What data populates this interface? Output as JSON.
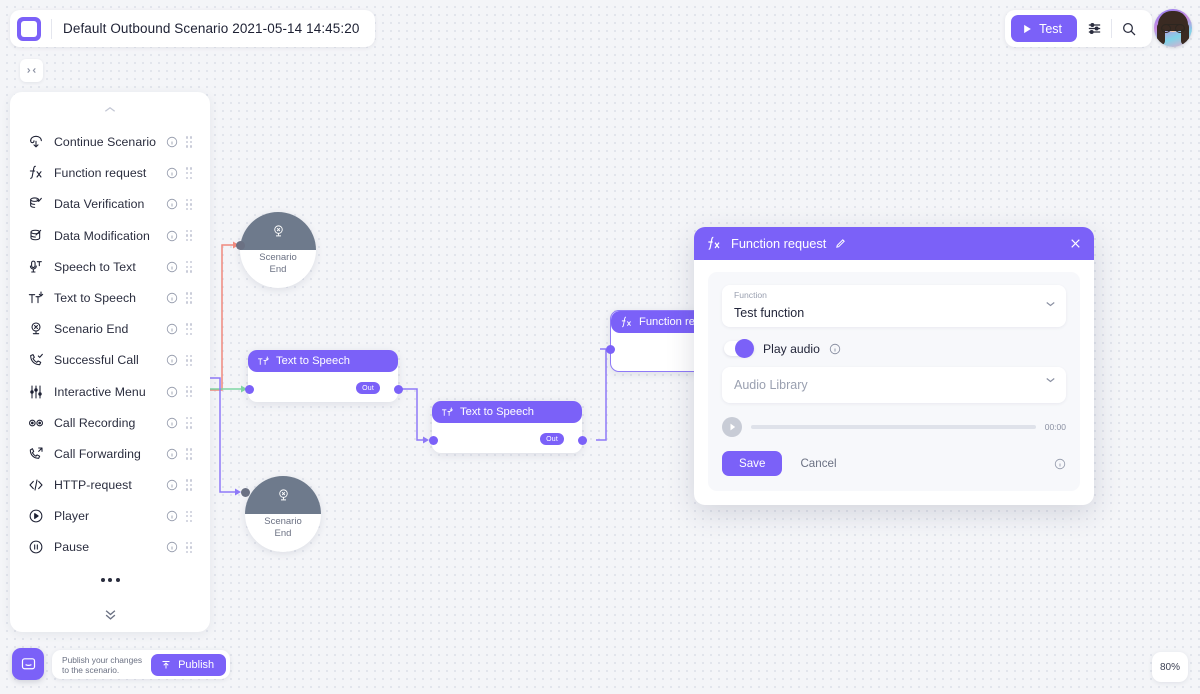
{
  "header": {
    "logo_icon": "edit-square-icon",
    "title": "Default Outbound Scenario 2021-05-14 14:45:20",
    "test_button": "Test",
    "settings_icon": "sliders-icon",
    "search_icon": "search-icon",
    "avatar": "user-avatar"
  },
  "sidebar": {
    "collapse_icon": "collapse-horizontal-icon",
    "scroll_up_icon": "chevron-up-icon",
    "scroll_down_icon": "chevrons-down-icon",
    "more_icon": "ellipsis-icon",
    "items": [
      {
        "label": "Continue Scenario",
        "icon": "continue-scenario-icon"
      },
      {
        "label": "Function request",
        "icon": "function-fx-icon"
      },
      {
        "label": "Data Verification",
        "icon": "data-verification-icon"
      },
      {
        "label": "Data Modification",
        "icon": "data-modification-icon"
      },
      {
        "label": "Speech to Text",
        "icon": "microphone-text-icon"
      },
      {
        "label": "Text to Speech",
        "icon": "text-speech-icon"
      },
      {
        "label": "Scenario End",
        "icon": "scenario-end-icon"
      },
      {
        "label": "Successful Call",
        "icon": "successful-call-icon"
      },
      {
        "label": "Interactive Menu",
        "icon": "sliders-menu-icon"
      },
      {
        "label": "Call Recording",
        "icon": "call-recording-icon"
      },
      {
        "label": "Call Forwarding",
        "icon": "call-forwarding-icon"
      },
      {
        "label": "HTTP-request",
        "icon": "code-brackets-icon"
      },
      {
        "label": "Player",
        "icon": "play-circle-icon"
      },
      {
        "label": "Pause",
        "icon": "pause-circle-icon"
      }
    ]
  },
  "canvas": {
    "nodes": [
      {
        "id": "end-top",
        "type": "scenario-end",
        "label": "Scenario\nEnd",
        "line1": "Scenario",
        "line2": "End",
        "icon": "scenario-end-icon"
      },
      {
        "id": "end-bot",
        "type": "scenario-end",
        "label": "Scenario\nEnd",
        "line1": "Scenario",
        "line2": "End",
        "icon": "scenario-end-icon"
      },
      {
        "id": "tts-1",
        "type": "text-to-speech",
        "label": "Text to Speech",
        "icon": "text-speech-icon",
        "out_badge": "Out"
      },
      {
        "id": "tts-2",
        "type": "text-to-speech",
        "label": "Text to Speech",
        "icon": "text-speech-icon",
        "out_badge": "Out"
      },
      {
        "id": "func-1",
        "type": "function-request",
        "label": "Function request",
        "icon": "function-fx-icon"
      }
    ],
    "edge_colors": {
      "red": "#f08a7e",
      "green": "#7fd6a4",
      "purple": "#8e79f7"
    }
  },
  "dialog": {
    "icon": "function-fx-icon",
    "title": "Function request",
    "edit_icon": "pencil-icon",
    "close_icon": "close-icon",
    "function_label": "Function",
    "function_value": "Test function",
    "play_audio_label": "Play audio",
    "play_audio_on": true,
    "info_icon": "info-icon",
    "audio_library_placeholder": "Audio Library",
    "player_time": "00:00",
    "play_icon": "play-icon",
    "save_label": "Save",
    "cancel_label": "Cancel"
  },
  "footer": {
    "chat_icon": "chat-bubble-icon",
    "publish_line1": "Publish your changes",
    "publish_line2": "to the scenario.",
    "publish_button": "Publish",
    "publish_icon": "upload-icon",
    "zoom_level": "80%"
  },
  "colors": {
    "accent": "#7b61f8",
    "canvas_bg": "#f4f5f8",
    "node_end_cap": "#6e7a8c"
  }
}
